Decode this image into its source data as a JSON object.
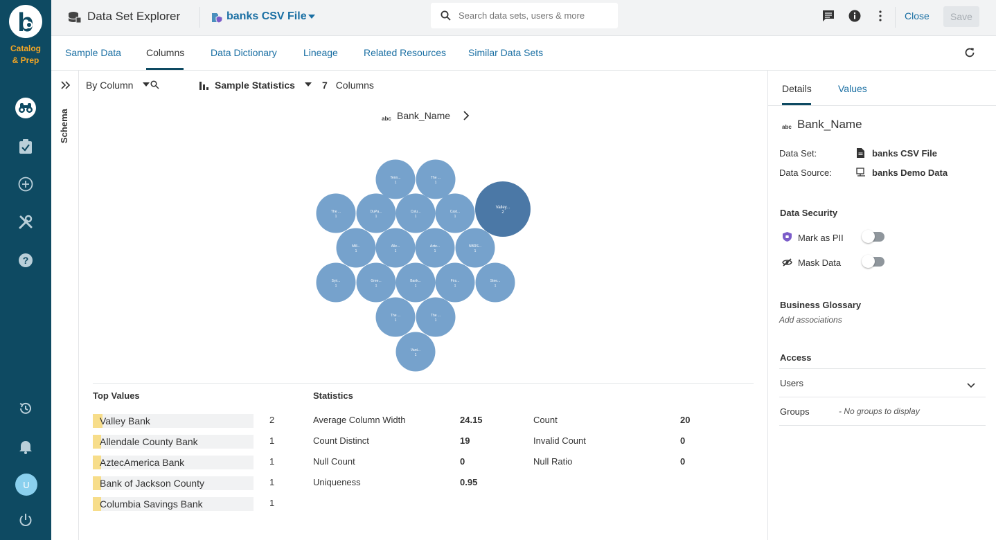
{
  "brand": {
    "line1": "Catalog",
    "line2": "& Prep"
  },
  "header": {
    "title": "Data Set Explorer",
    "dataset_name": "banks CSV File",
    "search_placeholder": "Search data sets, users & more",
    "close_label": "Close",
    "save_label": "Save"
  },
  "user": {
    "initial": "U"
  },
  "tabs": [
    {
      "label": "Sample Data"
    },
    {
      "label": "Columns",
      "active": true
    },
    {
      "label": "Data Dictionary"
    },
    {
      "label": "Lineage"
    },
    {
      "label": "Related Resources"
    },
    {
      "label": "Similar Data Sets"
    }
  ],
  "schema_label": "Schema",
  "toolbar": {
    "view_mode": "By Column",
    "stats_mode": "Sample Statistics",
    "column_count": "7",
    "columns_label": "Columns"
  },
  "column": {
    "type_badge": "abc",
    "name": "Bank_Name"
  },
  "bubbles": [
    {
      "label": "Tenn...",
      "count": "1"
    },
    {
      "label": "The ...",
      "count": "1"
    },
    {
      "label": "The ...",
      "count": "1"
    },
    {
      "label": "DuPa...",
      "count": "1"
    },
    {
      "label": "Colu...",
      "count": "1"
    },
    {
      "label": "Cast...",
      "count": "1"
    },
    {
      "label": "Valley...",
      "count": "2",
      "highlight": true
    },
    {
      "label": "Mill...",
      "count": "1"
    },
    {
      "label": "Alle...",
      "count": "1"
    },
    {
      "label": "Azte...",
      "count": "1"
    },
    {
      "label": "NBRS...",
      "count": "1"
    },
    {
      "label": "Syri...",
      "count": "1"
    },
    {
      "label": "Gree...",
      "count": "1"
    },
    {
      "label": "Bank...",
      "count": "1"
    },
    {
      "label": "Firs...",
      "count": "1"
    },
    {
      "label": "Stee...",
      "count": "1"
    },
    {
      "label": "The ...",
      "count": "1"
    },
    {
      "label": "The ...",
      "count": "1"
    },
    {
      "label": "Vant...",
      "count": "1"
    }
  ],
  "top_values": {
    "heading": "Top Values",
    "items": [
      {
        "label": "Valley Bank",
        "count": "2",
        "share": 0.06
      },
      {
        "label": "Allendale County Bank",
        "count": "1",
        "share": 0.05
      },
      {
        "label": "AztecAmerica Bank",
        "count": "1",
        "share": 0.05
      },
      {
        "label": "Bank of Jackson County",
        "count": "1",
        "share": 0.05
      },
      {
        "label": "Columbia Savings Bank",
        "count": "1",
        "share": 0.05
      }
    ]
  },
  "statistics": {
    "heading": "Statistics",
    "left": [
      {
        "label": "Average Column Width",
        "value": "24.15"
      },
      {
        "label": "Count Distinct",
        "value": "19"
      },
      {
        "label": "Null Count",
        "value": "0"
      },
      {
        "label": "Uniqueness",
        "value": "0.95"
      }
    ],
    "right": [
      {
        "label": "Count",
        "value": "20"
      },
      {
        "label": "Invalid Count",
        "value": "0"
      },
      {
        "label": "Null Ratio",
        "value": "0"
      }
    ]
  },
  "details": {
    "tabs": [
      "Details",
      "Values"
    ],
    "column_name": "Bank_Name",
    "dataset_label": "Data Set:",
    "dataset_value": "banks CSV File",
    "datasource_label": "Data Source:",
    "datasource_value": "banks Demo Data",
    "security_heading": "Data Security",
    "mark_pii": "Mark as PII",
    "mask_data": "Mask Data",
    "glossary_heading": "Business Glossary",
    "glossary_link": "Add associations",
    "access_heading": "Access",
    "users_label": "Users",
    "groups_label": "Groups",
    "groups_empty": "- No groups to display"
  },
  "colors": {
    "rail": "#0e4a62",
    "accent": "#1a6fa3",
    "bubble": "#76a2cc",
    "bubble_highlight": "#4b78a6",
    "bar": "#f7dd8a"
  }
}
